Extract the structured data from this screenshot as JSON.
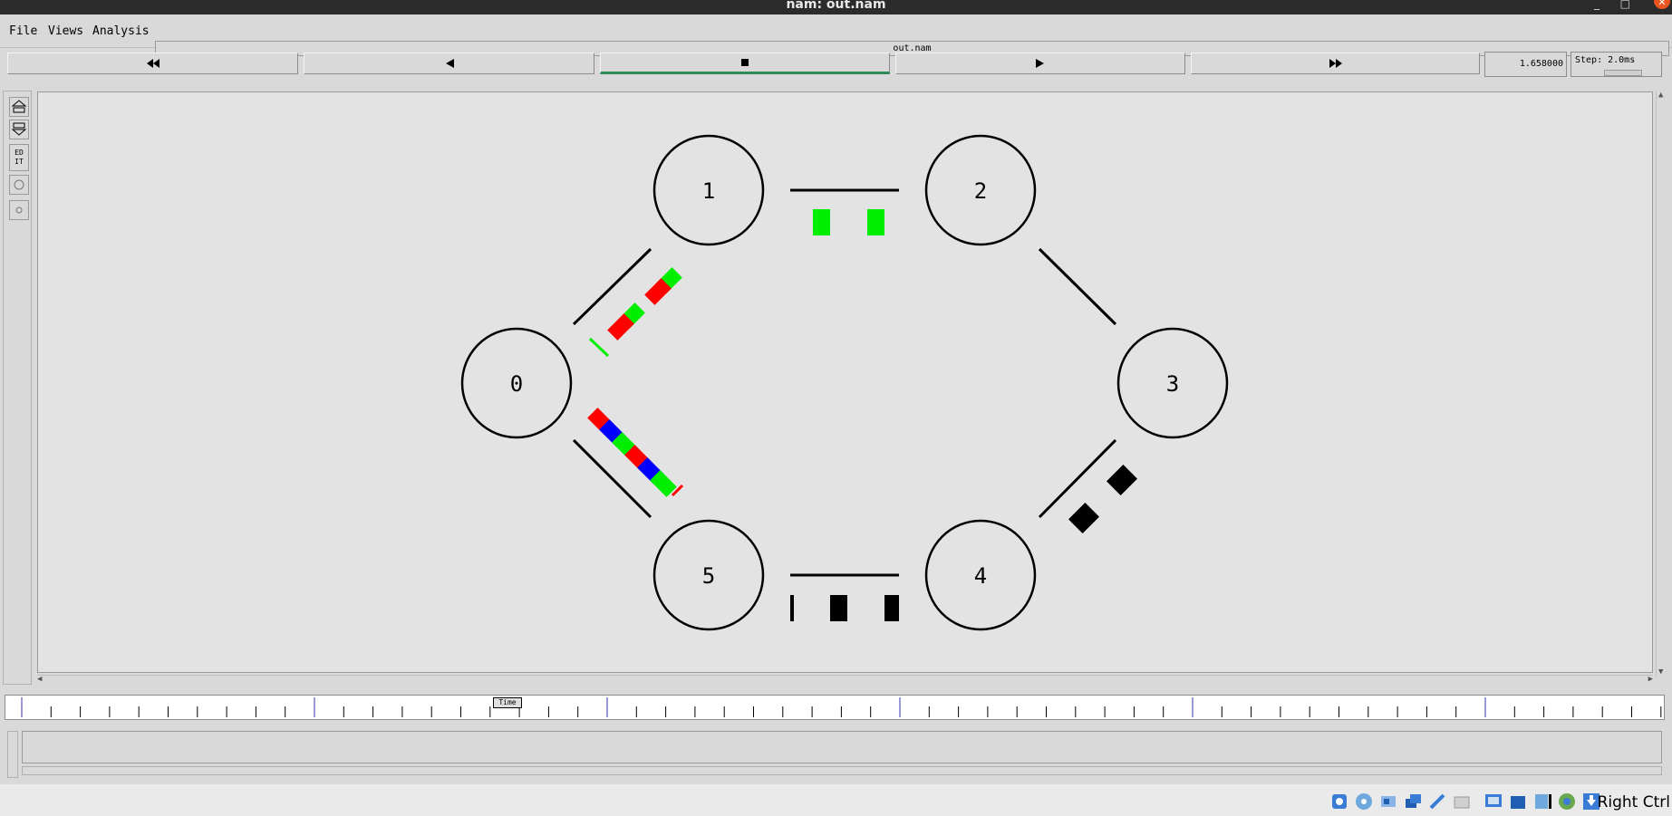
{
  "window": {
    "title": "nam: out.nam",
    "minimize": "_",
    "maximize": "□",
    "close": "✕"
  },
  "menu": {
    "file": "File",
    "views": "Views",
    "analysis": "Analysis",
    "filename": "out.nam"
  },
  "toolbar": {
    "buttons": [
      "rewind-fast",
      "step-back",
      "stop",
      "play",
      "fast-forward"
    ],
    "active": "stop",
    "active_color": "#2e8b57",
    "time": "1.658000",
    "step": "Step: 2.0ms"
  },
  "left_tools": {
    "edit_label": "ED IT"
  },
  "network": {
    "nodes": [
      "0",
      "1",
      "2",
      "3",
      "4",
      "5"
    ],
    "links": [
      [
        "0",
        "1"
      ],
      [
        "1",
        "2"
      ],
      [
        "2",
        "3"
      ],
      [
        "3",
        "4"
      ],
      [
        "4",
        "5"
      ],
      [
        "5",
        "0"
      ]
    ],
    "packet_colors": {
      "red": "#ff0000",
      "green": "#00ee00",
      "blue": "#0000ff",
      "black": "#000000"
    }
  },
  "timeline": {
    "label": "Time"
  },
  "statusbar": {
    "host_key": "Right Ctrl"
  }
}
